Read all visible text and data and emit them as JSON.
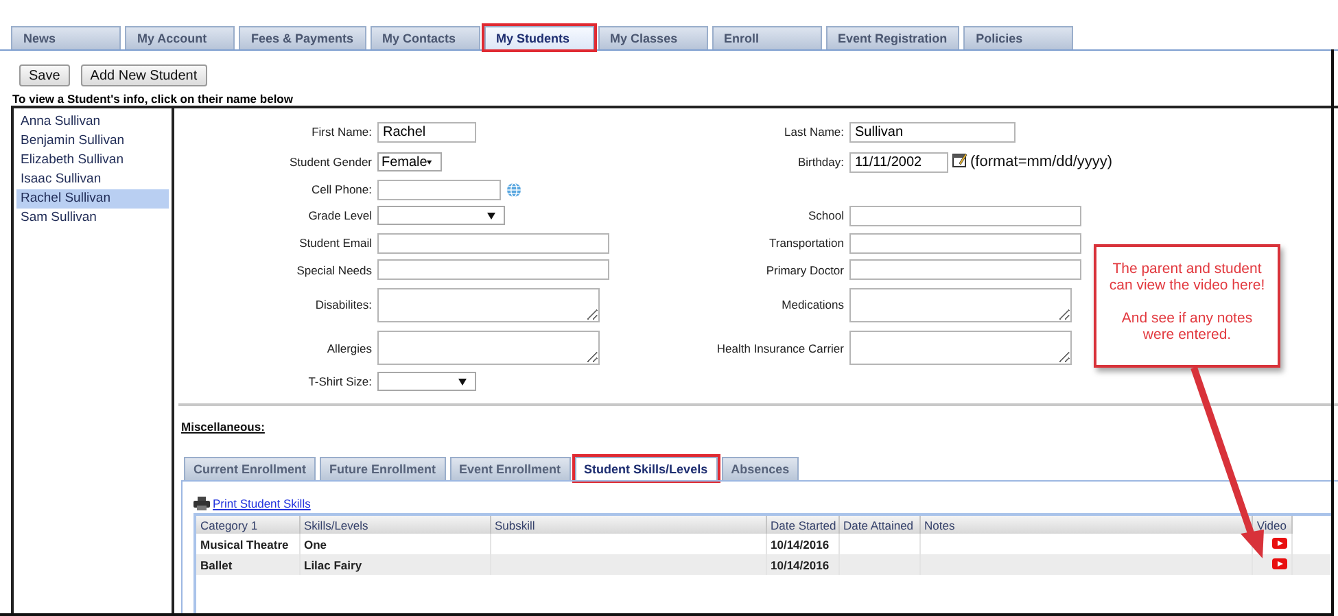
{
  "top_tabs": [
    {
      "label": "News",
      "selected": false,
      "highlighted": false
    },
    {
      "label": "My Account",
      "selected": false,
      "highlighted": false
    },
    {
      "label": "Fees & Payments",
      "selected": false,
      "highlighted": false
    },
    {
      "label": "My Contacts",
      "selected": false,
      "highlighted": false
    },
    {
      "label": "My Students",
      "selected": true,
      "highlighted": true
    },
    {
      "label": "My Classes",
      "selected": false,
      "highlighted": false
    },
    {
      "label": "Enroll",
      "selected": false,
      "highlighted": false
    },
    {
      "label": "Event Registration",
      "selected": false,
      "highlighted": false
    },
    {
      "label": "Policies",
      "selected": false,
      "highlighted": false
    }
  ],
  "buttons": [
    "Save",
    "Add New Student"
  ],
  "instruction": "To view a Student's info, click on their name below",
  "students": [
    {
      "name": "Anna Sullivan",
      "selected": false
    },
    {
      "name": "Benjamin Sullivan",
      "selected": false
    },
    {
      "name": "Elizabeth Sullivan",
      "selected": false
    },
    {
      "name": "Isaac Sullivan",
      "selected": false
    },
    {
      "name": "Rachel Sullivan",
      "selected": true
    },
    {
      "name": "Sam Sullivan",
      "selected": false
    }
  ],
  "form": {
    "rows": [
      {
        "left": {
          "label": "First Name:",
          "kind": "text",
          "value": "Rachel"
        },
        "right": {
          "label": "Last Name:",
          "kind": "text",
          "value": "Sullivan"
        }
      },
      {
        "left": {
          "label": "Student Gender",
          "kind": "select",
          "value": "Female"
        },
        "right": {
          "label": "Birthday:",
          "kind": "date",
          "value": "11/11/2002",
          "hint": "(format=mm/dd/yyyy)"
        }
      },
      {
        "left": {
          "label": "Cell Phone:",
          "kind": "phone"
        }
      },
      {
        "left": {
          "label": "Grade Level",
          "kind": "select"
        },
        "right": {
          "label": "School",
          "kind": "text"
        }
      },
      {
        "left": {
          "label": "Student Email",
          "kind": "text"
        },
        "right": {
          "label": "Transportation",
          "kind": "text"
        }
      },
      {
        "left": {
          "label": "Special Needs",
          "kind": "text"
        },
        "right": {
          "label": "Primary Doctor",
          "kind": "text"
        }
      },
      {
        "left": {
          "label": "Disabilites:",
          "kind": "textarea"
        },
        "right": {
          "label": "Medications",
          "kind": "textarea"
        }
      },
      {
        "left": {
          "label": "Allergies",
          "kind": "textarea"
        },
        "right": {
          "label": "Health Insurance Carrier",
          "kind": "textarea"
        }
      },
      {
        "left": {
          "label": "T-Shirt Size:",
          "kind": "select"
        }
      }
    ]
  },
  "section_title": "Miscellaneous:",
  "sub_tabs": [
    {
      "label": "Current Enrollment",
      "selected": false,
      "highlighted": false
    },
    {
      "label": "Future Enrollment",
      "selected": false,
      "highlighted": false
    },
    {
      "label": "Event Enrollment",
      "selected": false,
      "highlighted": false
    },
    {
      "label": "Student Skills/Levels",
      "selected": true,
      "highlighted": true
    },
    {
      "label": "Absences",
      "selected": false,
      "highlighted": false
    }
  ],
  "print_link": "Print Student Skills",
  "table": {
    "columns": [
      "Category 1",
      "Skills/Levels",
      "Subskill",
      "Date Started",
      "Date Attained",
      "Notes",
      "Video"
    ],
    "rows": [
      {
        "category": "Musical Theatre",
        "skill": "One",
        "date_started": "10/14/2016",
        "video": true
      },
      {
        "category": "Ballet",
        "skill": "Lilac Fairy",
        "date_started": "10/14/2016",
        "video": true
      }
    ]
  },
  "callout": {
    "paragraphs": [
      "The parent and student can view the video here!",
      "And see if any notes were entered."
    ]
  }
}
